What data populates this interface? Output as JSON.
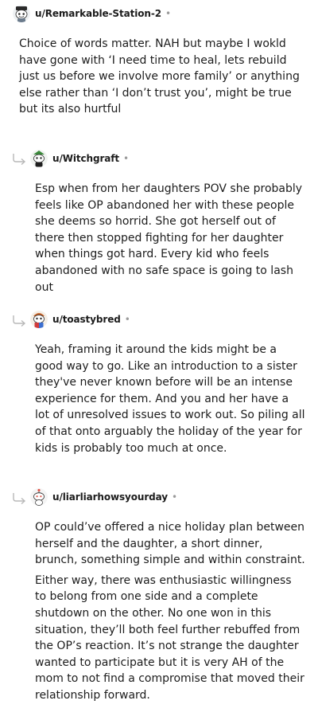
{
  "comments": [
    {
      "username": "u/Remarkable-Station-2",
      "separator": "•",
      "avatar": "snoo-avatar-icon",
      "paragraphs": [
        "Choice of words matter. NAH but maybe I wokld have gone with ‘I need time to heal, lets rebuild just us before we involve more family’ or anything else rather than ‘I don’t trust you’, might be true but its also hurtful"
      ]
    },
    {
      "username": "u/Witchgraft",
      "separator": "•",
      "avatar": "snoo-avatar-icon",
      "paragraphs": [
        "Esp when from her daughters POV she probably feels like OP abandoned her with these people she deems so horrid. She got herself out of there then stopped fighting for her daughter when things got hard. Every kid who feels abandoned with no safe space is going to lash out"
      ]
    },
    {
      "username": "u/toastybred",
      "separator": "•",
      "avatar": "snoo-avatar-icon",
      "paragraphs": [
        "Yeah, framing it around the kids might be a good way to go. Like an introduction to a sister they've never known before will be an intense experience for them. And you and her have a lot of unresolved issues to work out. So piling all of that onto arguably the holiday of the year for kids is probably too much at once."
      ]
    },
    {
      "username": "u/liarliarhowsyourday",
      "separator": "•",
      "avatar": "snoo-avatar-icon",
      "paragraphs": [
        "OP could’ve offered a nice holiday plan between herself and the daughter, a short dinner, brunch, something simple and within constraint.",
        "Either way, there was enthusiastic willingness to belong from one side and a complete shutdown on the other. No one won in this situation, they’ll both feel further rebuffed from the OP’s reaction. It’s not strange the daughter wanted to participate but it is very AH of the mom to not find a compromise that moved their relationship forward."
      ]
    }
  ]
}
